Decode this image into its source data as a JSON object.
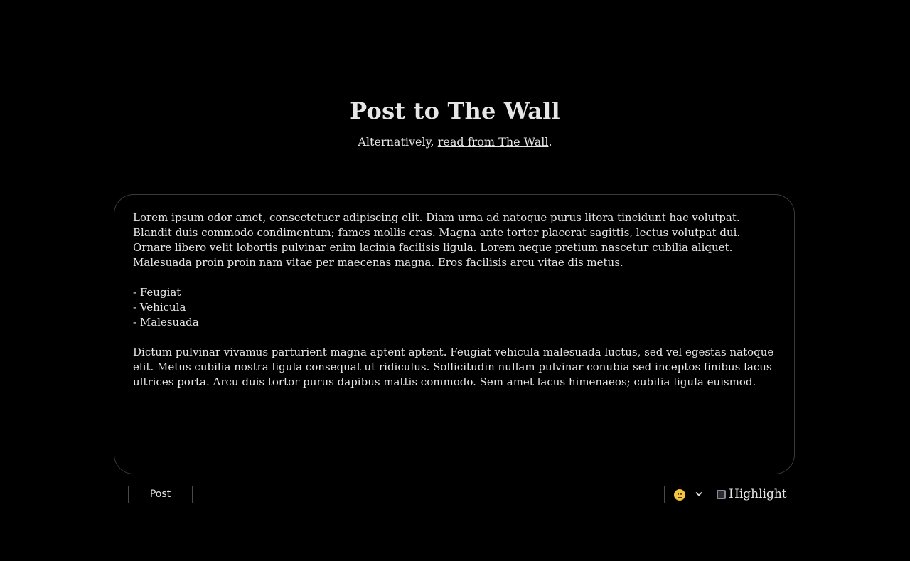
{
  "header": {
    "title": "Post to The Wall",
    "subtitle_prefix": "Alternatively, ",
    "subtitle_link": "read from The Wall",
    "subtitle_suffix": "."
  },
  "editor": {
    "paragraph_1": "Lorem ipsum odor amet, consectetuer adipiscing elit. Diam urna ad natoque purus litora tincidunt hac volutpat. Blandit duis commodo condimentum; fames mollis cras. Magna ante tortor placerat sagittis, lectus volutpat dui. Ornare libero velit lobortis pulvinar enim lacinia facilisis ligula. Lorem neque pretium nascetur cubilia aliquet. Malesuada proin proin nam vitae per maecenas magna. Eros facilisis arcu vitae dis metus.",
    "list_items": [
      "- Feugiat",
      "- Vehicula",
      "- Malesuada"
    ],
    "paragraph_2": "Dictum pulvinar vivamus parturient magna aptent aptent. Feugiat vehicula malesuada luctus, sed vel egestas natoque elit. Metus cubilia nostra ligula consequat ut ridiculus. Sollicitudin nullam pulvinar conubia sed inceptos finibus lacus ultrices porta. Arcu duis tortor purus dapibus mattis commodo. Sem amet lacus himenaeos; cubilia ligula euismod."
  },
  "controls": {
    "post_label": "Post",
    "mood_selected_icon": "neutral-face-emoji",
    "highlight_label": "Highlight",
    "highlight_checked": false
  },
  "colors": {
    "background": "#000000",
    "text": "#e6e6e6",
    "border": "#3a3a3a",
    "emoji": "#f4c542"
  }
}
